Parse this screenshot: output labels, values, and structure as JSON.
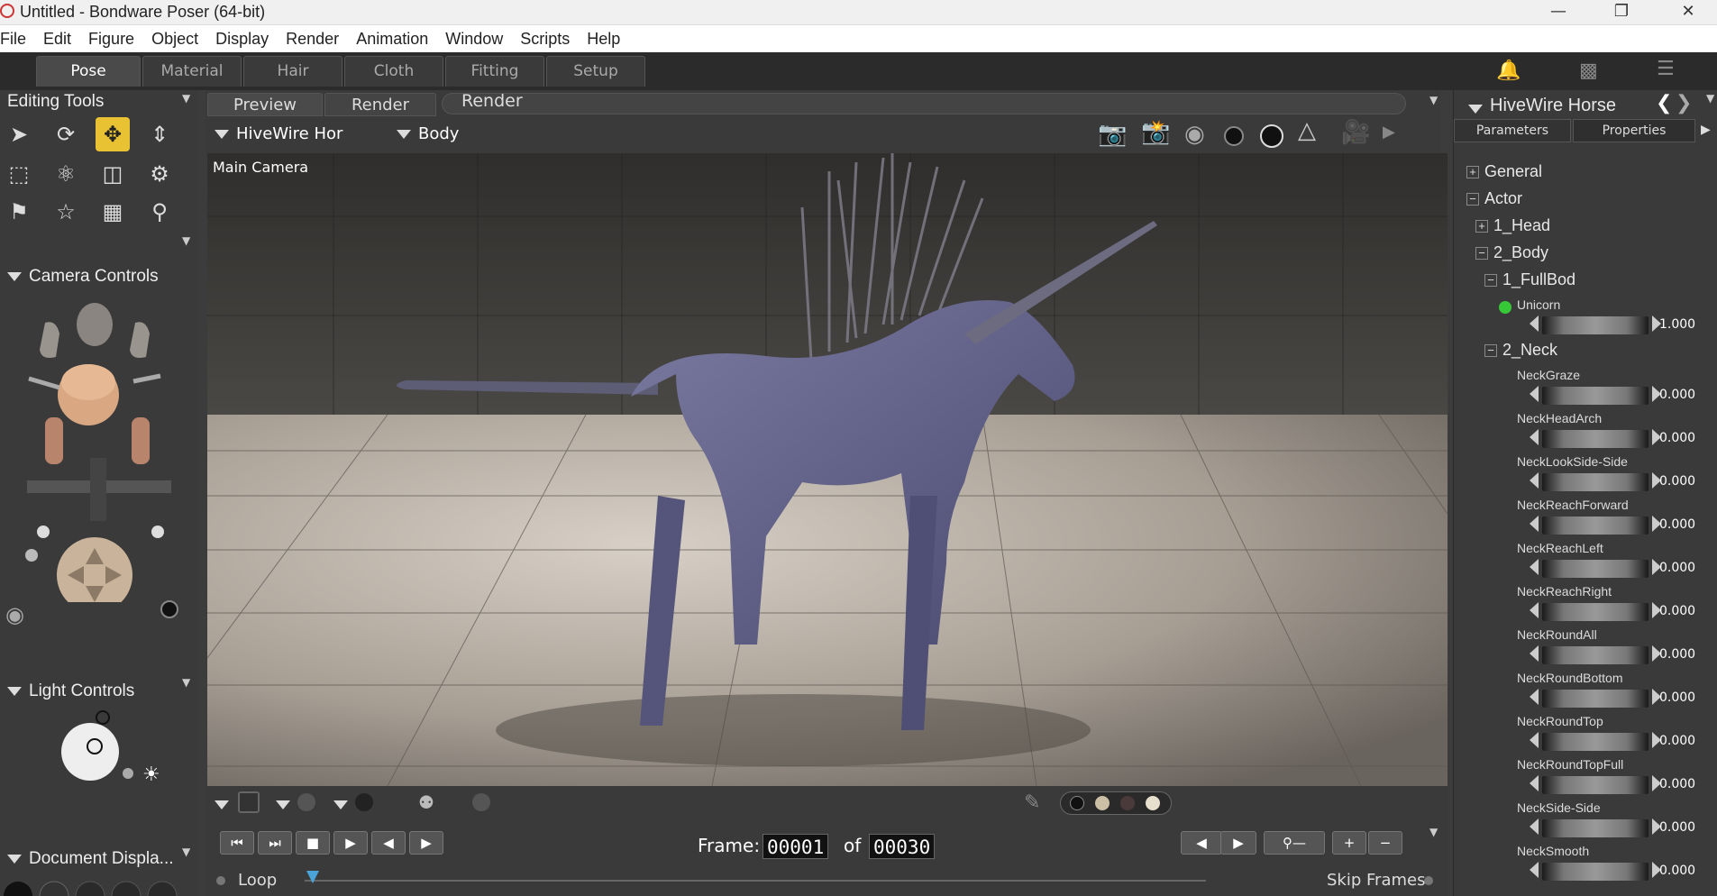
{
  "window": {
    "title": "Untitled - Bondware Poser (64-bit)"
  },
  "menu": [
    "File",
    "Edit",
    "Figure",
    "Object",
    "Display",
    "Render",
    "Animation",
    "Window",
    "Scripts",
    "Help"
  ],
  "rooms": [
    "Pose",
    "Material",
    "Hair",
    "Cloth",
    "Fitting",
    "Setup"
  ],
  "left": {
    "editing_tools": "Editing Tools",
    "camera_controls": "Camera Controls",
    "light_controls": "Light Controls",
    "document_display": "Document Displa..."
  },
  "view": {
    "tabs": [
      "Preview",
      "Render"
    ],
    "render_label": "Render",
    "figure_select": "HiveWire Hor",
    "actor_select": "Body",
    "camera_name": "Main Camera"
  },
  "timeline": {
    "frame_label": "Frame:",
    "frame_current": "00001",
    "of_label": "of",
    "frame_total": "00030",
    "loop_label": "Loop",
    "skip_frames_label": "Skip Frames"
  },
  "right": {
    "figure_title": "HiveWire Horse",
    "tabs": [
      "Parameters",
      "Properties"
    ],
    "tree": [
      {
        "label": "General",
        "sym": "+"
      },
      {
        "label": "Actor",
        "sym": "−"
      },
      {
        "label": "1_Head",
        "sym": "+"
      },
      {
        "label": "2_Body",
        "sym": "−"
      },
      {
        "label": "1_FullBod",
        "sym": "−"
      }
    ],
    "unicorn": {
      "label": "Unicorn",
      "value": "1.000"
    },
    "neck_group": "2_Neck",
    "params": [
      {
        "name": "NeckGraze",
        "value": "0.000"
      },
      {
        "name": "NeckHeadArch",
        "value": "0.000"
      },
      {
        "name": "NeckLookSide-Side",
        "value": "0.000"
      },
      {
        "name": "NeckReachForward",
        "value": "0.000"
      },
      {
        "name": "NeckReachLeft",
        "value": "0.000"
      },
      {
        "name": "NeckReachRight",
        "value": "0.000"
      },
      {
        "name": "NeckRoundAll",
        "value": "0.000"
      },
      {
        "name": "NeckRoundBottom",
        "value": "0.000"
      },
      {
        "name": "NeckRoundTop",
        "value": "0.000"
      },
      {
        "name": "NeckRoundTopFull",
        "value": "0.000"
      },
      {
        "name": "NeckSide-Side",
        "value": "0.000"
      },
      {
        "name": "NeckSmooth",
        "value": "0.000"
      }
    ]
  },
  "colors": {
    "active_tool": "#e8c233",
    "panel_bg": "#3a3a3a",
    "dark_bg": "#2b2b2b",
    "unicorn_dot": "#37c837"
  }
}
